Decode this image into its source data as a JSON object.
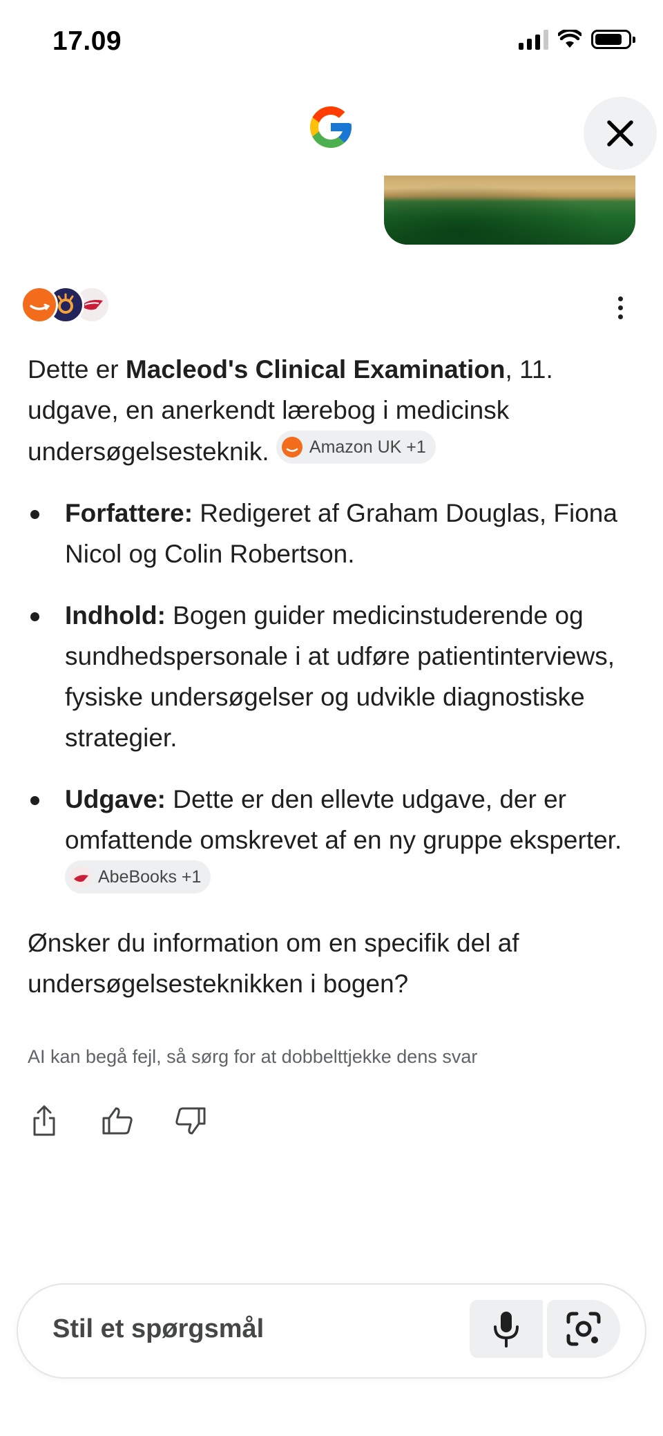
{
  "status_bar": {
    "time": "17.09"
  },
  "header": {
    "logo_icon": "google-g-icon",
    "close_icon": "close-icon"
  },
  "sources": {
    "icons": [
      "amazon-icon",
      "bibliotek-icon",
      "abebooks-icon"
    ],
    "more_icon": "more-vert-icon"
  },
  "answer": {
    "intro_prefix": "Dette er ",
    "intro_bold": "Macleod's Clinical Examination",
    "intro_suffix": ", 11. udgave, en anerkendt lærebog i medicinsk undersøgelsesteknik.",
    "intro_chip": "Amazon UK +1",
    "bullets": [
      {
        "label": "Forfattere:",
        "text": " Redigeret af Graham Douglas, Fiona Nicol og Colin Robertson."
      },
      {
        "label": "Indhold:",
        "text": " Bogen guider medicinstuderende og sundhedspersonale i at udføre patientinterviews, fysiske undersøgelser og udvikle diagnostiske strategier."
      },
      {
        "label": "Udgave:",
        "text": " Dette er den ellevte udgave, der er omfattende omskrevet af en ny gruppe eksperter.",
        "chip": "AbeBooks +1"
      }
    ],
    "followup": "Ønsker du information om en specifik del af undersøgelsesteknikken i bogen?"
  },
  "disclaimer": "AI kan begå fejl, så sørg for at dobbelttjekke dens svar",
  "actions": [
    "share-icon",
    "thumbs-up-icon",
    "thumbs-down-icon"
  ],
  "ask_bar": {
    "placeholder": "Stil et spørgsmål",
    "mic_icon": "microphone-icon",
    "lens_icon": "camera-lens-icon"
  },
  "colors": {
    "text": "#1f1f1f",
    "chip_bg": "#edeff1",
    "amazon": "#f26c1c",
    "close_bg": "#eff1f3"
  }
}
